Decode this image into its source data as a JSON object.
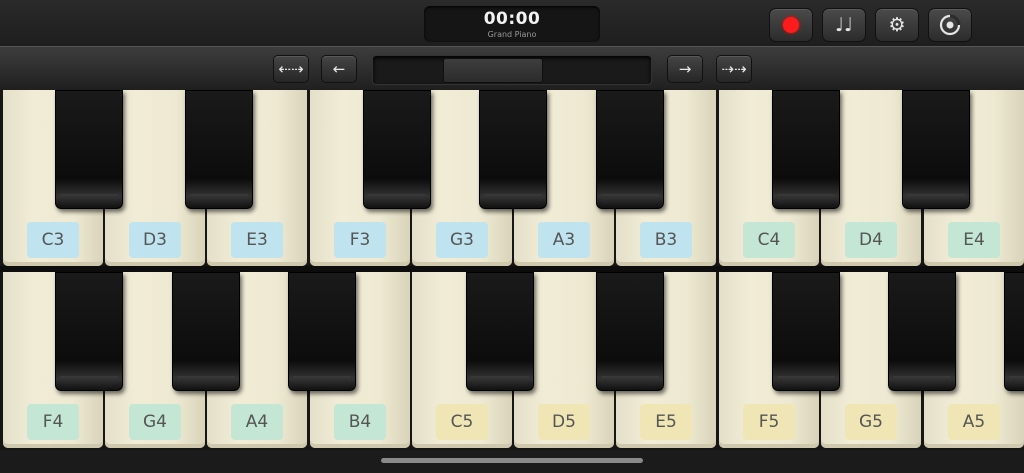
{
  "display": {
    "time": "00:00",
    "instrument": "Grand Piano"
  },
  "toolbar": {
    "icons": [
      "record-icon",
      "notes-icon",
      "gear-icon",
      "loop-icon"
    ],
    "record_color": "#ff1b1b"
  },
  "nav": {
    "arrows": [
      "⇠⇢",
      "←",
      "→",
      "⇢⇢"
    ]
  },
  "keyboard_upper": {
    "keys": [
      {
        "note": "C3",
        "color": "blue"
      },
      {
        "note": "D3",
        "color": "blue"
      },
      {
        "note": "E3",
        "color": "blue"
      },
      {
        "note": "F3",
        "color": "blue"
      },
      {
        "note": "G3",
        "color": "blue"
      },
      {
        "note": "A3",
        "color": "blue"
      },
      {
        "note": "B3",
        "color": "blue"
      },
      {
        "note": "C4",
        "color": "green"
      },
      {
        "note": "D4",
        "color": "green"
      },
      {
        "note": "E4",
        "color": "green"
      }
    ]
  },
  "keyboard_lower": {
    "keys": [
      {
        "note": "F4",
        "color": "green"
      },
      {
        "note": "G4",
        "color": "green"
      },
      {
        "note": "A4",
        "color": "green"
      },
      {
        "note": "B4",
        "color": "green"
      },
      {
        "note": "C5",
        "color": "yellow"
      },
      {
        "note": "D5",
        "color": "yellow"
      },
      {
        "note": "E5",
        "color": "yellow"
      },
      {
        "note": "F5",
        "color": "yellow"
      },
      {
        "note": "G5",
        "color": "yellow"
      },
      {
        "note": "A5",
        "color": "yellow"
      }
    ]
  },
  "label_colors": {
    "blue": "#bfe3ef",
    "green": "#c4e6d5",
    "yellow": "#f0e6b5"
  }
}
